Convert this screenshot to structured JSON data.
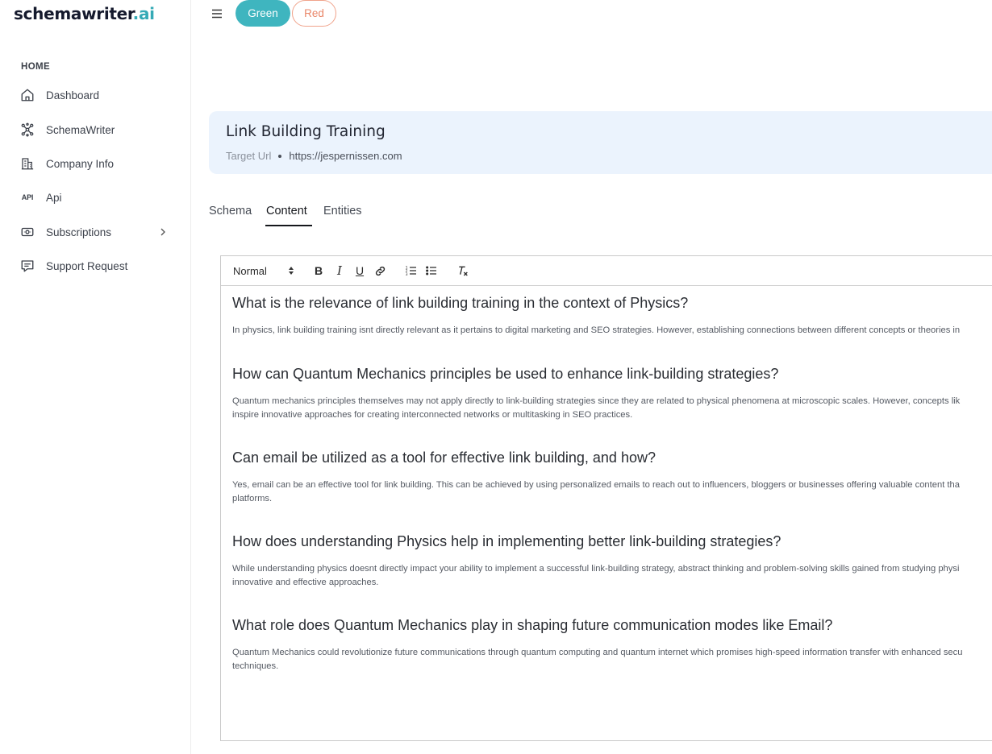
{
  "app": {
    "logo_main": "schemawriter",
    "logo_accent": ".ai"
  },
  "sidebar": {
    "heading": "HOME",
    "items": [
      {
        "label": "Dashboard",
        "icon": "home-icon"
      },
      {
        "label": "SchemaWriter",
        "icon": "network-icon"
      },
      {
        "label": "Company Info",
        "icon": "building-icon"
      },
      {
        "label": "Api",
        "icon": "api-icon",
        "icon_text": "API"
      },
      {
        "label": "Subscriptions",
        "icon": "subscription-icon",
        "has_submenu": true
      },
      {
        "label": "Support Request",
        "icon": "message-icon"
      }
    ]
  },
  "topbar": {
    "green_label": "Green",
    "red_label": "Red"
  },
  "header": {
    "title": "Link Building Training",
    "target_label": "Target Url",
    "target_value": "https://jespernissen.com"
  },
  "tabs": [
    {
      "label": "Schema",
      "active": false
    },
    {
      "label": "Content",
      "active": true
    },
    {
      "label": "Entities",
      "active": false
    }
  ],
  "editor": {
    "format_select": "Normal",
    "sections": [
      {
        "question": "What is the relevance of link building training in the context of Physics?",
        "answer_lines": [
          "In physics, link building training isnt directly relevant as it pertains to digital marketing and SEO strategies. However, establishing connections between different concepts or theories in"
        ]
      },
      {
        "question": "How can Quantum Mechanics principles be used to enhance link-building strategies?",
        "answer_lines": [
          "Quantum mechanics principles themselves may not apply directly to link-building strategies since they are related to physical phenomena at microscopic scales. However, concepts lik",
          "inspire innovative approaches for creating interconnected networks or multitasking in SEO practices."
        ]
      },
      {
        "question": "Can email be utilized as a tool for effective link building, and how?",
        "answer_lines": [
          "Yes, email can be an effective tool for link building. This can be achieved by using personalized emails to reach out to influencers, bloggers or businesses offering valuable content tha",
          "platforms."
        ]
      },
      {
        "question": "How does understanding Physics help in implementing better link-building strategies?",
        "answer_lines": [
          "While understanding physics doesnt directly impact your ability to implement a successful link-building strategy, abstract thinking and problem-solving skills gained from studying physi",
          "innovative and effective approaches."
        ]
      },
      {
        "question": "What role does Quantum Mechanics play in shaping future communication modes like Email?",
        "answer_lines": [
          "Quantum Mechanics could revolutionize future communications through quantum computing and quantum internet which promises high-speed information transfer with enhanced secu",
          "techniques."
        ]
      }
    ]
  },
  "colors": {
    "accent": "#35aab6",
    "green_pill": "#3fb5bf",
    "red_pill": "#e98568",
    "header_bg": "#ebf3fd"
  }
}
